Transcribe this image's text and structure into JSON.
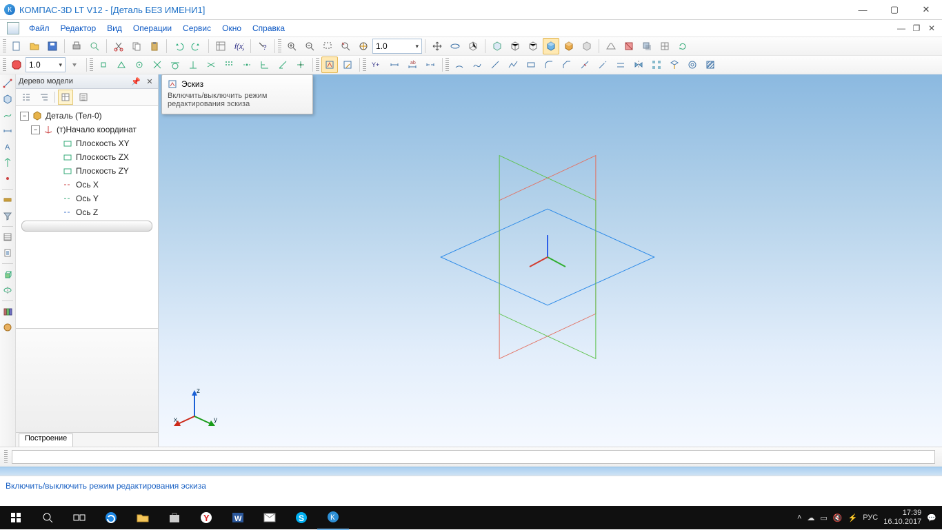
{
  "window": {
    "title": "КОМПАС-3D LT V12 - [Деталь БЕЗ ИМЕНИ1]"
  },
  "menu": [
    "Файл",
    "Редактор",
    "Вид",
    "Операции",
    "Сервис",
    "Окно",
    "Справка"
  ],
  "toolbar1_combo": "1.0",
  "toolbar2_combo": "1.0",
  "tree": {
    "panel_title": "Дерево модели",
    "root": "Деталь (Тел-0)",
    "origin": "(т)Начало координат",
    "children": [
      "Плоскость XY",
      "Плоскость ZX",
      "Плоскость ZY",
      "Ось X",
      "Ось Y",
      "Ось Z"
    ],
    "tab": "Построение"
  },
  "tooltip": {
    "title": "Эскиз",
    "body": "Включить/выключить режим редактирования эскиза"
  },
  "triad": {
    "x": "x",
    "y": "y",
    "z": "z"
  },
  "status": "Включить/выключить режим редактирования эскиза",
  "taskbar": {
    "lang": "РУС",
    "time": "17:39",
    "date": "16.10.2017"
  }
}
